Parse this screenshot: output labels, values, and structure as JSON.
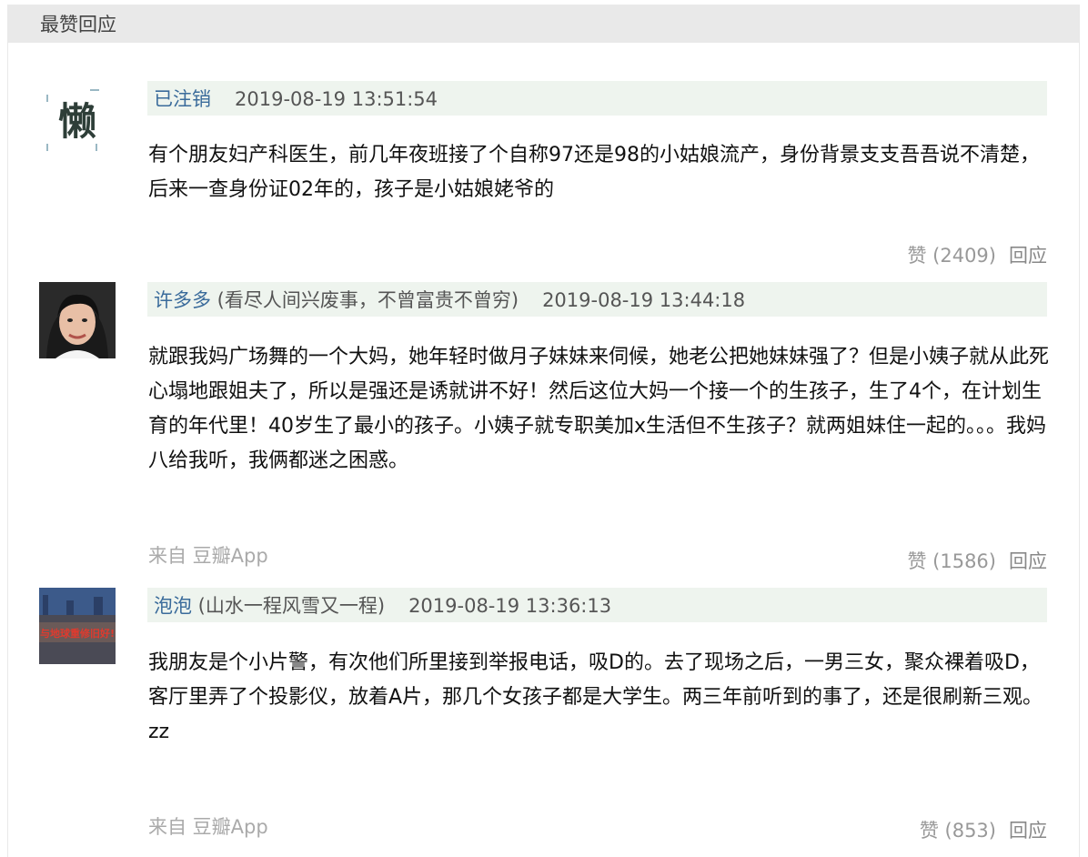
{
  "header": {
    "title": "最赞回应"
  },
  "comments": [
    {
      "author": "已注销",
      "signature": "",
      "time": "2019-08-19 13:51:54",
      "text": "有个朋友妇产科医生，前几年夜班接了个自称97还是98的小姑娘流产，身份背景支支吾吾说不清楚，后来一查身份证02年的，孩子是小姑娘姥爷的",
      "via": "",
      "likes": "赞 (2409)",
      "reply": "回应",
      "avatar_glyph": "懒"
    },
    {
      "author": "许多多",
      "signature": " (看尽人间兴废事，不曾富贵不曾穷)",
      "time": "2019-08-19 13:44:18",
      "text": "就跟我妈广场舞的一个大妈，她年轻时做月子妹妹来伺候，她老公把她妹妹强了？但是小姨子就从此死心塌地跟姐夫了，所以是强还是诱就讲不好！然后这位大妈一个接一个的生孩子，生了4个，在计划生育的年代里！40岁生了最小的孩子。小姨子就专职美加x生活但不生孩子？就两姐妹住一起的。。。我妈八给我听，我俩都迷之困惑。",
      "via": "来自 豆瓣App",
      "likes": "赞 (1586)",
      "reply": "回应"
    },
    {
      "author": "泡泡",
      "signature": " (山水一程风雪又一程)",
      "time": "2019-08-19 13:36:13",
      "text": "我朋友是个小片警，有次他们所里接到举报电话，吸D的。去了现场之后，一男三女，聚众裸着吸D，客厅里弄了个投影仪，放着A片，那几个女孩子都是大学生。两三年前听到的事了，还是很刷新三观。zz",
      "via": "来自 豆瓣App",
      "likes": "赞 (853)",
      "reply": "回应",
      "avatar_text": "与地球重修旧好!"
    }
  ]
}
